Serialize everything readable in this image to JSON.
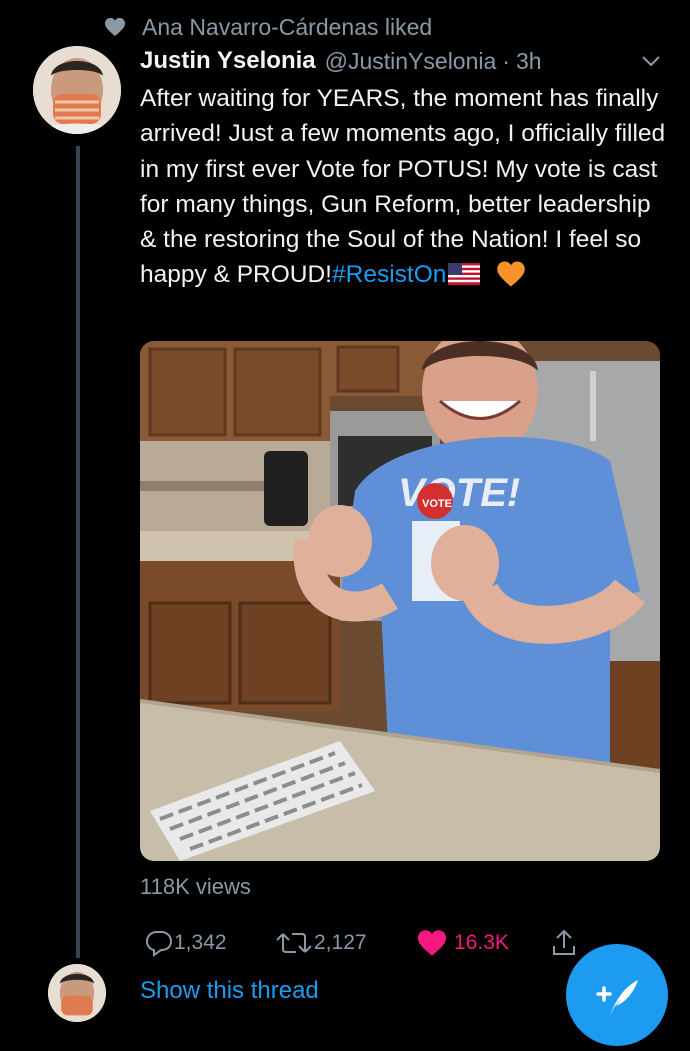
{
  "social_context": {
    "text": "Ana Navarro-Cárdenas liked"
  },
  "tweet": {
    "author_name": "Justin Yselonia",
    "handle": "@JustinYselonia",
    "separator": "·",
    "time": "3h",
    "text_before_hashtag": "After waiting for YEARS, the moment has finally arrived! Just a few moments ago, I officially filled in my first ever Vote for POTUS! My vote is cast for many things, Gun Reform, better leadership & the restoring the Soul of the Nation! I feel so happy & PROUD!",
    "hashtag": "#ResistOn",
    "media": {
      "shirt_text": "VOTE!",
      "badge_text": "VOTE"
    },
    "views": "118K views",
    "actions": {
      "replies": "1,342",
      "retweets": "2,127",
      "likes": "16.3K"
    }
  },
  "show_thread": "Show this thread",
  "icons": [
    "heart-icon",
    "chevron-down-icon",
    "flag-icon",
    "orange-heart-icon",
    "reply-icon",
    "retweet-icon",
    "like-icon",
    "share-icon",
    "compose-icon"
  ],
  "colors": {
    "accent": "#1d9bf0",
    "like": "#f91880",
    "secondary_text": "#8b98a5",
    "background": "#000000"
  }
}
